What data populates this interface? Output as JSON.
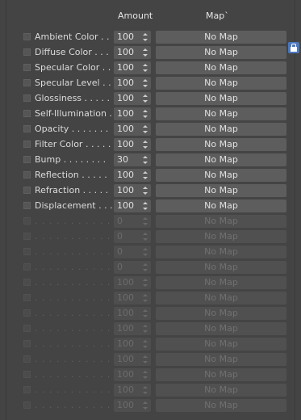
{
  "header": {
    "amount": "Amount",
    "map": "Map`"
  },
  "rows": [
    {
      "label": "Ambient Color . . .",
      "amount": "100",
      "map": "No Map",
      "enabled": true
    },
    {
      "label": "Diffuse Color . . . .",
      "amount": "100",
      "map": "No Map",
      "enabled": true
    },
    {
      "label": "Specular Color  . .",
      "amount": "100",
      "map": "No Map",
      "enabled": true
    },
    {
      "label": "Specular Level  . .",
      "amount": "100",
      "map": "No Map",
      "enabled": true
    },
    {
      "label": "Glossiness  . . . . .",
      "amount": "100",
      "map": "No Map",
      "enabled": true
    },
    {
      "label": "Self-Illumination . .",
      "amount": "100",
      "map": "No Map",
      "enabled": true
    },
    {
      "label": "Opacity . . . . . . .",
      "amount": "100",
      "map": "No Map",
      "enabled": true
    },
    {
      "label": "Filter Color  . . . . .",
      "amount": "100",
      "map": "No Map",
      "enabled": true
    },
    {
      "label": "Bump  . . . . . . . .",
      "amount": "30",
      "map": "No Map",
      "enabled": true
    },
    {
      "label": "Reflection  . . . . .",
      "amount": "100",
      "map": "No Map",
      "enabled": true
    },
    {
      "label": "Refraction  . . . . .",
      "amount": "100",
      "map": "No Map",
      "enabled": true
    },
    {
      "label": "Displacement  . . .",
      "amount": "100",
      "map": "No Map",
      "enabled": true
    },
    {
      "label": ". . . . . . . . . . . .",
      "amount": "0",
      "map": "No Map",
      "enabled": false
    },
    {
      "label": ". . . . . . . . . . . .",
      "amount": "0",
      "map": "No Map",
      "enabled": false
    },
    {
      "label": ". . . . . . . . . . . .",
      "amount": "0",
      "map": "No Map",
      "enabled": false
    },
    {
      "label": ". . . . . . . . . . . .",
      "amount": "0",
      "map": "No Map",
      "enabled": false
    },
    {
      "label": ". . . . . . . . . . . .",
      "amount": "100",
      "map": "No Map",
      "enabled": false
    },
    {
      "label": ". . . . . . . . . . . .",
      "amount": "100",
      "map": "No Map",
      "enabled": false
    },
    {
      "label": ". . . . . . . . . . . .",
      "amount": "100",
      "map": "No Map",
      "enabled": false
    },
    {
      "label": ". . . . . . . . . . . .",
      "amount": "100",
      "map": "No Map",
      "enabled": false
    },
    {
      "label": ". . . . . . . . . . . .",
      "amount": "100",
      "map": "No Map",
      "enabled": false
    },
    {
      "label": ". . . . . . . . . . . .",
      "amount": "100",
      "map": "No Map",
      "enabled": false
    },
    {
      "label": ". . . . . . . . . . . .",
      "amount": "100",
      "map": "No Map",
      "enabled": false
    },
    {
      "label": ". . . . . . . . . . . .",
      "amount": "100",
      "map": "No Map",
      "enabled": false
    },
    {
      "label": ". . . . . . . . . . . .",
      "amount": "100",
      "map": "No Map",
      "enabled": false
    }
  ],
  "lock_icon": "lock-icon",
  "colors": {
    "accent": "#4a78c0",
    "panel": "#444444"
  }
}
